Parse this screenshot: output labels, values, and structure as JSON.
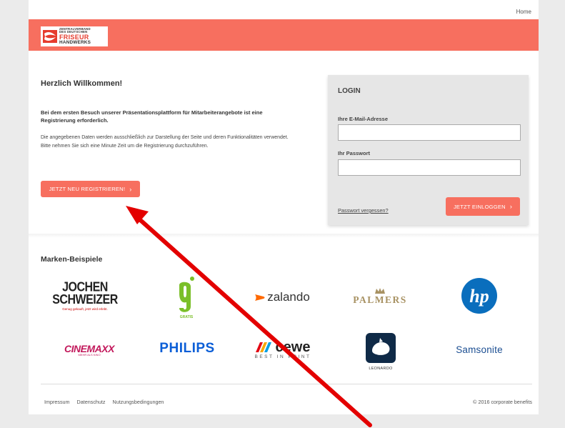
{
  "nav": {
    "home": "Home"
  },
  "logo": {
    "line1": "ZENTRALVERBAND",
    "line2": "DES DEUTSCHEN",
    "line3": "FRISEUR",
    "line4": "HANDWERKS"
  },
  "welcome": {
    "title": "Herzlich Willkommen!",
    "lead": "Bei dem ersten Besuch unserer Präsentationsplattform für Mitarbeiterangebote ist eine Registrierung erforderlich.",
    "body": "Die angegebenen Daten werden ausschließlich zur Darstellung der Seite und deren Funktionalitäten verwendet. Bitte nehmen Sie sich eine Minute Zeit um die Registrierung durchzuführen.",
    "register_label": "JETZT NEU REGISTRIEREN!"
  },
  "login": {
    "title": "LOGIN",
    "email_label": "Ihre E-Mail-Adresse",
    "email_value": "",
    "password_label": "Ihr Passwort",
    "password_value": "",
    "forgot_label": "Passwort vergessen?",
    "submit_label": "JETZT EINLOGGEN"
  },
  "brands": {
    "title": "Marken-Beispiele",
    "items": [
      {
        "name": "JOCHEN SCHWEIZER",
        "tagline": "Genug gekauft, jetzt wird erlebt."
      },
      {
        "name": "g",
        "tagline": "GRATIS"
      },
      {
        "name": "zalando"
      },
      {
        "name": "PALMERS"
      },
      {
        "name": "hp"
      },
      {
        "name": "CINEMAXX",
        "tagline": "MEHR ALS KINO"
      },
      {
        "name": "PHILIPS"
      },
      {
        "name": "cewe",
        "tagline": "BEST IN PRINT"
      },
      {
        "name": "LEONARDO"
      },
      {
        "name": "Samsonite"
      }
    ]
  },
  "footer": {
    "links": [
      "Impressum",
      "Datenschutz",
      "Nutzungsbedingungen"
    ],
    "copyright": "© 2016 corporate benefits"
  },
  "colors": {
    "accent": "#f76f5f",
    "annotation_arrow": "#e30000"
  }
}
